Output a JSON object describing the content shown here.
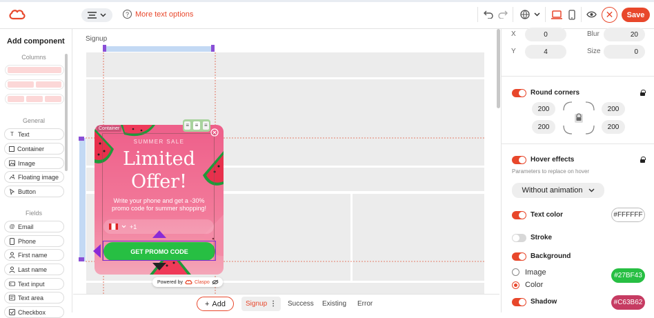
{
  "header": {
    "more_text_options": "More text options",
    "save_label": "Save",
    "icons": [
      "logo-icon",
      "align-icon",
      "chevron-down-icon",
      "help-icon",
      "undo-icon",
      "redo-icon",
      "globe-icon",
      "desktop-icon",
      "mobile-icon",
      "preview-eye-icon",
      "close-icon"
    ]
  },
  "left_panel": {
    "title": "Add component",
    "columns_section": "Columns",
    "general_section": "General",
    "fields_section": "Fields",
    "general_items": [
      "Text",
      "Container",
      "Image",
      "Floating image",
      "Button"
    ],
    "field_items": [
      "Email",
      "Phone",
      "First name",
      "Last name",
      "Text input",
      "Text area",
      "Checkbox"
    ]
  },
  "canvas": {
    "page_label": "Signup",
    "container_tag": "Container",
    "popup": {
      "subtitle": "SUMMER SALE",
      "title_line1": "Limited",
      "title_line2": "Offer!",
      "description": "Write your phone and get a -30% promo code for summer shopping!",
      "phone_code": "+1",
      "button_label": "GET PROMO CODE"
    },
    "powered_by": "Powered by",
    "brand": "Claspo"
  },
  "bottom_bar": {
    "add_label": "Add",
    "active_tab": "Signup",
    "tabs": [
      "Success",
      "Existing",
      "Error"
    ]
  },
  "right_panel": {
    "x_label": "X",
    "x_value": "0",
    "blur_label": "Blur",
    "blur_value": "20",
    "y_label": "Y",
    "y_value": "4",
    "size_label": "Size",
    "size_value": "0",
    "round_corners_label": "Round corners",
    "corner_tl": "200",
    "corner_tr": "200",
    "corner_bl": "200",
    "corner_br": "200",
    "hover_effects_label": "Hover effects",
    "hover_hint": "Parameters to replace on hover",
    "hover_animation": "Without animation",
    "text_color_label": "Text color",
    "text_color_value": "#FFFFFF",
    "stroke_label": "Stroke",
    "background_label": "Background",
    "bg_image_label": "Image",
    "bg_color_label": "Color",
    "bg_color_value": "#27BF43",
    "shadow_label": "Shadow",
    "shadow_value": "#C63B62"
  },
  "colors": {
    "accent": "#e8472b",
    "button_green": "#27bf43",
    "popup_pink": "#ee5f8a",
    "shadow_color": "#c63b62"
  }
}
